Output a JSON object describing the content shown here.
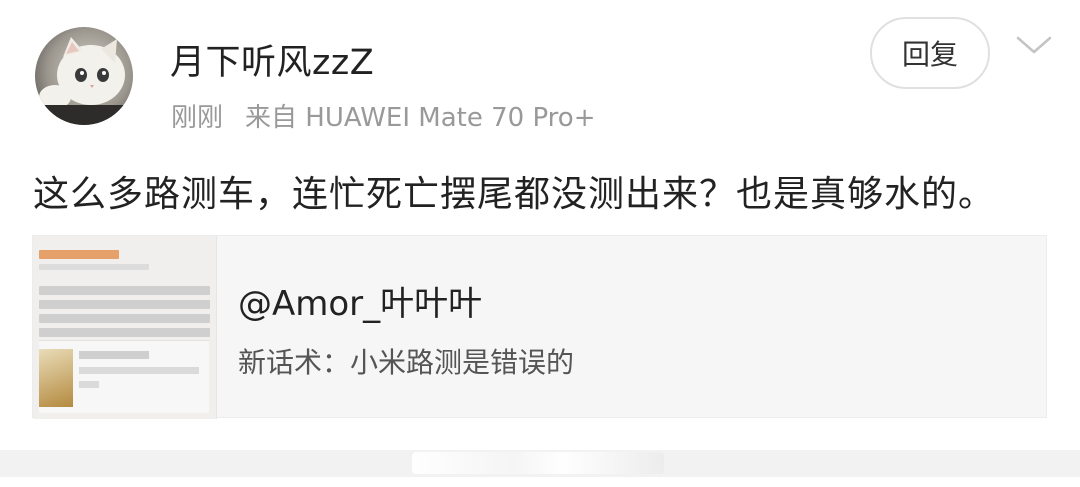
{
  "post": {
    "username": "月下听风zzZ",
    "time": "刚刚",
    "source": "来自 HUAWEI Mate 70 Pro+",
    "content": "这么多路测车，连忙死亡摆尾都没测出来？也是真够水的。"
  },
  "actions": {
    "reply_label": "回复",
    "menu_icon": "chevron-down-icon"
  },
  "quote": {
    "author": "@Amor_叶叶叶",
    "text": "新话术：小米路测是错误的"
  },
  "colors": {
    "username": "#222222",
    "meta": "#999999",
    "card_bg": "#f6f6f6"
  }
}
